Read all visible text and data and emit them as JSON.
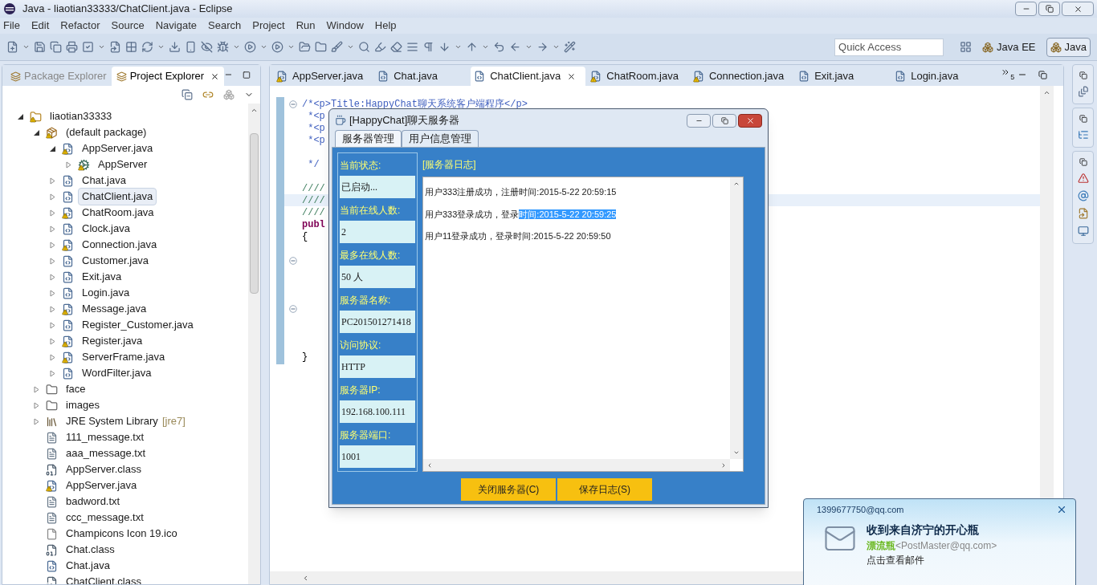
{
  "window": {
    "title": "Java - liaotian33333/ChatClient.java - Eclipse"
  },
  "menu": [
    "File",
    "Edit",
    "Refactor",
    "Source",
    "Navigate",
    "Search",
    "Project",
    "Run",
    "Window",
    "Help"
  ],
  "quick_access": {
    "placeholder": "Quick Access"
  },
  "perspectives": [
    {
      "label": "Java EE",
      "selected": false
    },
    {
      "label": "Java",
      "selected": true
    }
  ],
  "explorer_tabs": [
    {
      "label": "Package Explorer",
      "selected": false
    },
    {
      "label": "Project Explorer",
      "selected": true
    }
  ],
  "tree": [
    {
      "label": "liaotian33333",
      "kind": "project",
      "warning": true,
      "selected": false,
      "expanded": true,
      "children": [
        {
          "label": "(default package)",
          "kind": "package",
          "warning": true,
          "selected": false,
          "expanded": true,
          "children": [
            {
              "label": "AppServer.java",
              "kind": "java",
              "warning": true,
              "selected": false,
              "expanded": true,
              "children": [
                {
                  "label": "AppServer",
                  "kind": "type",
                  "warning": true,
                  "selected": false,
                  "expanded": false
                }
              ]
            },
            {
              "label": "Chat.java",
              "kind": "java",
              "warning": false,
              "selected": false,
              "expanded": false
            },
            {
              "label": "ChatClient.java",
              "kind": "java",
              "warning": false,
              "selected": true,
              "expanded": false
            },
            {
              "label": "ChatRoom.java",
              "kind": "java",
              "warning": true,
              "selected": false,
              "expanded": false
            },
            {
              "label": "Clock.java",
              "kind": "java",
              "warning": false,
              "selected": false,
              "expanded": false
            },
            {
              "label": "Connection.java",
              "kind": "java",
              "warning": true,
              "selected": false,
              "expanded": false
            },
            {
              "label": "Customer.java",
              "kind": "java",
              "warning": false,
              "selected": false,
              "expanded": false
            },
            {
              "label": "Exit.java",
              "kind": "java",
              "warning": false,
              "selected": false,
              "expanded": false
            },
            {
              "label": "Login.java",
              "kind": "java",
              "warning": false,
              "selected": false,
              "expanded": false
            },
            {
              "label": "Message.java",
              "kind": "java",
              "warning": true,
              "selected": false,
              "expanded": false
            },
            {
              "label": "Register_Customer.java",
              "kind": "java",
              "warning": false,
              "selected": false,
              "expanded": false
            },
            {
              "label": "Register.java",
              "kind": "java",
              "warning": true,
              "selected": false,
              "expanded": false
            },
            {
              "label": "ServerFrame.java",
              "kind": "java",
              "warning": true,
              "selected": false,
              "expanded": false
            },
            {
              "label": "WordFilter.java",
              "kind": "java",
              "warning": false,
              "selected": false,
              "expanded": false
            }
          ]
        },
        {
          "label": "face",
          "kind": "folder",
          "warning": false,
          "selected": false,
          "expanded": false
        },
        {
          "label": "images",
          "kind": "folder",
          "warning": false,
          "selected": false,
          "expanded": false
        },
        {
          "label": "JRE System Library",
          "decoration": "[jre7]",
          "kind": "library",
          "warning": false,
          "selected": false,
          "expanded": false
        },
        {
          "label": "111_message.txt",
          "kind": "text",
          "warning": false,
          "selected": false
        },
        {
          "label": "aaa_message.txt",
          "kind": "text",
          "warning": false,
          "selected": false
        },
        {
          "label": "AppServer.class",
          "kind": "class",
          "warning": false,
          "selected": false
        },
        {
          "label": "AppServer.java",
          "kind": "java",
          "warning": true,
          "selected": false
        },
        {
          "label": "badword.txt",
          "kind": "text",
          "warning": false,
          "selected": false
        },
        {
          "label": "ccc_message.txt",
          "kind": "text",
          "warning": false,
          "selected": false
        },
        {
          "label": "Champicons Icon 19.ico",
          "kind": "file",
          "warning": false,
          "selected": false
        },
        {
          "label": "Chat.class",
          "kind": "class",
          "warning": false,
          "selected": false
        },
        {
          "label": "Chat.java",
          "kind": "java",
          "warning": false,
          "selected": false
        },
        {
          "label": "ChatClient.class",
          "kind": "class",
          "warning": false,
          "selected": false
        }
      ]
    }
  ],
  "editor_tabs": [
    {
      "label": "AppServer.java",
      "warning": true,
      "selected": false
    },
    {
      "label": "Chat.java",
      "warning": false,
      "selected": false
    },
    {
      "label": "ChatClient.java",
      "warning": false,
      "selected": true
    },
    {
      "label": "ChatRoom.java",
      "warning": true,
      "selected": false
    },
    {
      "label": "Connection.java",
      "warning": true,
      "selected": false
    },
    {
      "label": "Exit.java",
      "warning": false,
      "selected": false
    },
    {
      "label": "Login.java",
      "warning": false,
      "selected": false
    }
  ],
  "hidden_tab_count": "5",
  "code_lines": [
    {
      "text": "/*<p>Title:HappyChat聊天系统客户端程序</p>",
      "kind": "javadoc",
      "fold": true,
      "current": false
    },
    {
      "text": " *<p",
      "kind": "javadoc",
      "fold": false,
      "current": false
    },
    {
      "text": " *<p",
      "kind": "javadoc",
      "fold": false,
      "current": false
    },
    {
      "text": " *<p",
      "kind": "javadoc",
      "fold": false,
      "current": false
    },
    {
      "fold": false,
      "current": false
    },
    {
      "text": " */",
      "kind": "javadoc",
      "fold": false,
      "current": false
    },
    {
      "fold": false,
      "current": false
    },
    {
      "text": "////",
      "kind": "comment",
      "fold": false,
      "current": false
    },
    {
      "text": "////",
      "kind": "comment",
      "fold": false,
      "current": true
    },
    {
      "text": "////",
      "kind": "comment",
      "fold": false,
      "current": false
    },
    {
      "text": "publ",
      "kind": "keyword",
      "fold": false,
      "current": false
    },
    {
      "text": "{",
      "kind": "plain",
      "fold": false,
      "current": false
    },
    {
      "fold": false,
      "current": false
    },
    {
      "fold": true,
      "current": false
    },
    {
      "fold": false,
      "current": false
    },
    {
      "fold": false,
      "current": false
    },
    {
      "fold": false,
      "current": false
    },
    {
      "fold": true,
      "current": false
    },
    {
      "fold": false,
      "current": false
    },
    {
      "fold": false,
      "current": false
    },
    {
      "fold": false,
      "current": false
    },
    {
      "text": "}",
      "kind": "plain",
      "fold": false,
      "current": false
    }
  ],
  "dialog": {
    "title": "[HappyChat]聊天服务器",
    "tabs": [
      {
        "label": "服务器管理",
        "selected": true
      },
      {
        "label": "用户信息管理",
        "selected": false
      }
    ],
    "fields": [
      {
        "label": "当前状态:",
        "value": "已启动..."
      },
      {
        "label": "当前在线人数:",
        "value": "2"
      },
      {
        "label": "最多在线人数:",
        "value": "50 人"
      },
      {
        "label": "服务器名称:",
        "value": "PC201501271418"
      },
      {
        "label": "访问协议:",
        "value": "HTTP"
      },
      {
        "label": "服务器IP:",
        "value": "192.168.100.111"
      },
      {
        "label": "服务器端口:",
        "value": "1001"
      }
    ],
    "log_title": "[服务器日志]",
    "log_lines": [
      {
        "text": "用户333注册成功，注册时间:2015-5-22 20:59:15"
      },
      {
        "text": "用户333登录成功，登录",
        "selected_part": "时间:2015-5-22 20:59:25"
      },
      {
        "text": "用户11登录成功，登录时间:2015-5-22 20:59:50"
      }
    ],
    "buttons": [
      "关闭服务器(C)",
      "保存日志(S)"
    ]
  },
  "notification": {
    "account": "1399677750@qq.com",
    "title": "收到来自济宁的开心瓶",
    "sender_name": "漂流瓶",
    "sender_address": "<PostMaster@qq.com>",
    "action": "点击查看邮件"
  }
}
